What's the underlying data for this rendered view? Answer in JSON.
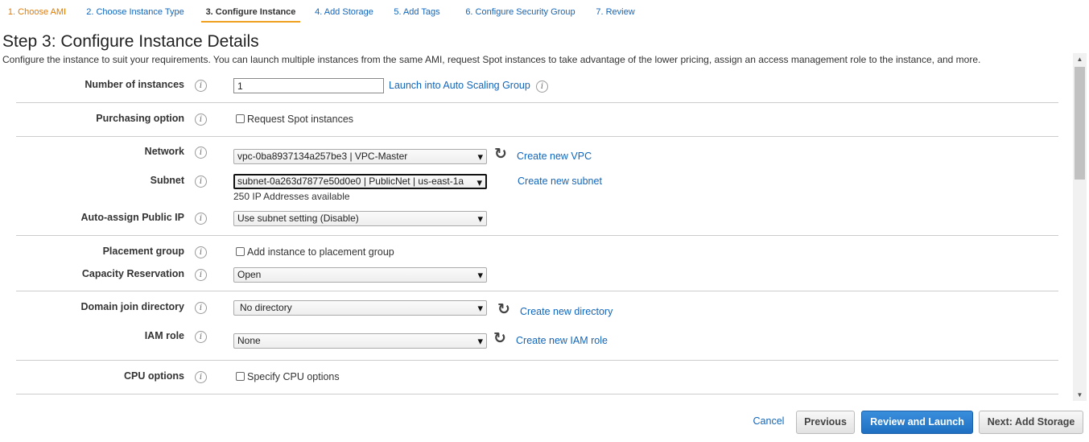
{
  "wizard": {
    "tabs": [
      {
        "label": "1. Choose AMI",
        "state": "done"
      },
      {
        "label": "2. Choose Instance Type",
        "state": "default"
      },
      {
        "label": "3. Configure Instance",
        "state": "active"
      },
      {
        "label": "4. Add Storage",
        "state": "default"
      },
      {
        "label": "5. Add Tags",
        "state": "default"
      },
      {
        "label": "6. Configure Security Group",
        "state": "default"
      },
      {
        "label": "7. Review",
        "state": "default"
      }
    ]
  },
  "page": {
    "title": "Step 3: Configure Instance Details",
    "description": "Configure the instance to suit your requirements. You can launch multiple instances from the same AMI, request Spot instances to take advantage of the lower pricing, assign an access management role to the instance, and more."
  },
  "form": {
    "instances": {
      "label": "Number of instances",
      "value": "1",
      "link": "Launch into Auto Scaling Group"
    },
    "purchasing": {
      "label": "Purchasing option",
      "checkbox_label": "Request Spot instances",
      "checked": false
    },
    "network": {
      "label": "Network",
      "value": "vpc-0ba8937134a257be3 | VPC-Master",
      "link": "Create new VPC"
    },
    "subnet": {
      "label": "Subnet",
      "value": "subnet-0a263d7877e50d0e0 | PublicNet | us-east-1a",
      "hint": "250 IP Addresses available",
      "link": "Create new subnet"
    },
    "public_ip": {
      "label": "Auto-assign Public IP",
      "value": "Use subnet setting (Disable)"
    },
    "placement": {
      "label": "Placement group",
      "checkbox_label": "Add instance to placement group",
      "checked": false
    },
    "capacity": {
      "label": "Capacity Reservation",
      "value": "Open"
    },
    "domain": {
      "label": "Domain join directory",
      "value": "No directory",
      "link": "Create new directory"
    },
    "iam": {
      "label": "IAM role",
      "value": "None",
      "link": "Create new IAM role"
    },
    "cpu": {
      "label": "CPU options",
      "checkbox_label": "Specify CPU options",
      "checked": false
    }
  },
  "icons": {
    "info": "info-icon",
    "refresh": "refresh-icon",
    "info_glyph": "i",
    "refresh_glyph": "↻",
    "dropdown_glyph": "▲▼"
  },
  "footer": {
    "cancel": "Cancel",
    "previous": "Previous",
    "review_launch": "Review and Launch",
    "next": "Next: Add Storage"
  },
  "colors": {
    "link": "#1166bb",
    "done_tab": "#e07b00",
    "active_tab_underline": "#f0a020",
    "primary_button": "#1f6fc2"
  }
}
